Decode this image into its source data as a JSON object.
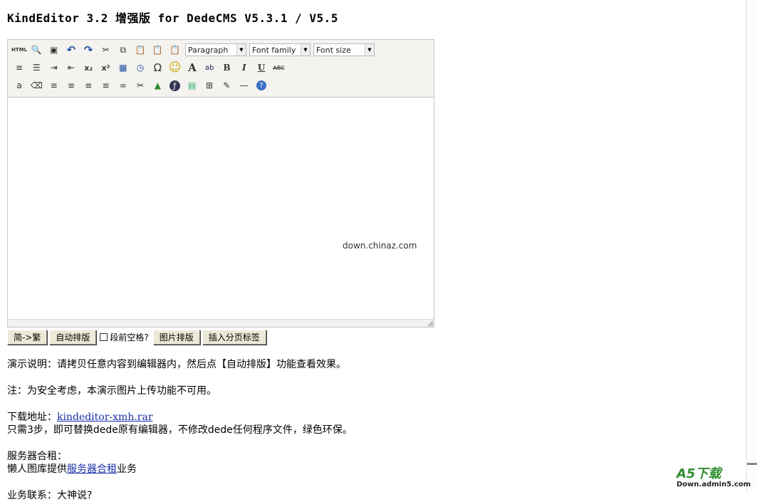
{
  "page": {
    "title": "KindEditor 3.2 增强版 for DedeCMS V5.3.1 / V5.5"
  },
  "editor": {
    "toolbar": {
      "row1": [
        {
          "name": "source-html-icon",
          "glyph": "HTML"
        },
        {
          "name": "preview-icon",
          "glyph": "🔍"
        },
        {
          "name": "fullscreen-icon",
          "glyph": "▣"
        },
        {
          "name": "undo-icon",
          "glyph": "↶"
        },
        {
          "name": "redo-icon",
          "glyph": "↷"
        },
        {
          "name": "cut-icon",
          "glyph": "✂"
        },
        {
          "name": "copy-icon",
          "glyph": "⧉"
        },
        {
          "name": "paste-icon",
          "glyph": "📋"
        },
        {
          "name": "paste-plain-icon",
          "glyph": "📋"
        },
        {
          "name": "paste-word-icon",
          "glyph": "📋"
        }
      ],
      "selects": [
        {
          "name": "format-select",
          "label": "Paragraph"
        },
        {
          "name": "font-family-select",
          "label": "Font family"
        },
        {
          "name": "font-size-select",
          "label": "Font size"
        }
      ],
      "row2": [
        {
          "name": "ordered-list-icon",
          "glyph": "≡"
        },
        {
          "name": "unordered-list-icon",
          "glyph": "☰"
        },
        {
          "name": "indent-icon",
          "glyph": "⇥"
        },
        {
          "name": "outdent-icon",
          "glyph": "⇤"
        },
        {
          "name": "subscript-icon",
          "glyph": "x₂"
        },
        {
          "name": "superscript-icon",
          "glyph": "x²"
        },
        {
          "name": "date-icon",
          "glyph": "▦"
        },
        {
          "name": "time-icon",
          "glyph": "◷"
        },
        {
          "name": "special-char-icon",
          "glyph": "Ω"
        },
        {
          "name": "emoticon-icon",
          "glyph": "☺"
        },
        {
          "name": "text-color-icon",
          "glyph": "A"
        },
        {
          "name": "highlight-icon",
          "glyph": "ab"
        },
        {
          "name": "bold-icon",
          "glyph": "B"
        },
        {
          "name": "italic-icon",
          "glyph": "I"
        },
        {
          "name": "underline-icon",
          "glyph": "U"
        },
        {
          "name": "strikethrough-icon",
          "glyph": "ABC"
        }
      ],
      "row3": [
        {
          "name": "select-all-icon",
          "glyph": "a"
        },
        {
          "name": "remove-format-icon",
          "glyph": "⌫"
        },
        {
          "name": "align-left-icon",
          "glyph": "≡"
        },
        {
          "name": "align-center-icon",
          "glyph": "≡"
        },
        {
          "name": "align-right-icon",
          "glyph": "≡"
        },
        {
          "name": "align-justify-icon",
          "glyph": "≡"
        },
        {
          "name": "link-icon",
          "glyph": "∞"
        },
        {
          "name": "unlink-icon",
          "glyph": "✂"
        },
        {
          "name": "image-icon",
          "glyph": "▲"
        },
        {
          "name": "flash-icon",
          "glyph": "ƒ"
        },
        {
          "name": "media-icon",
          "glyph": "▤"
        },
        {
          "name": "table-icon",
          "glyph": "⊞"
        },
        {
          "name": "layer-icon",
          "glyph": "✎"
        },
        {
          "name": "horizontal-rule-icon",
          "glyph": "—"
        },
        {
          "name": "about-icon",
          "glyph": "?"
        }
      ]
    },
    "watermark": "down.chinaz.com"
  },
  "actions": {
    "simplified_traditional": "简->繁",
    "auto_format": "自动排版",
    "leading_space_label": "段前空格?",
    "image_format": "图片排版",
    "insert_page_break": "插入分页标签"
  },
  "content": {
    "demo_note": "演示说明：请拷贝任意内容到编辑器内，然后点【自动排版】功能查看效果。",
    "security_note": "注：为安全考虑，本演示图片上传功能不可用。",
    "download_label": "下载地址：",
    "download_link": "kindeditor-xmh.rar",
    "steps_note": "只需3步，即可替换dede原有编辑器，不修改dede任何程序文件，绿色环保。",
    "server_heading": "服务器合租：",
    "server_prefix": "懒人图库提供",
    "server_link": "服务器合租",
    "server_suffix": "业务",
    "cutoff_line": "业务联系：大神说?"
  },
  "logo": {
    "big": "A5下载",
    "small": "Down.admin5.com"
  }
}
